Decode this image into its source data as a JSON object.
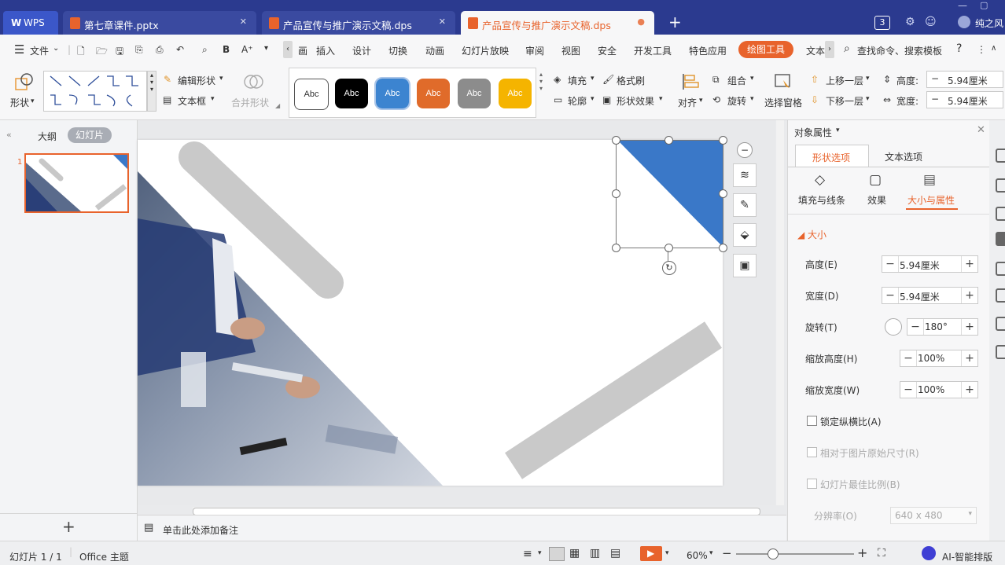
{
  "tabs": {
    "wps": "WPS",
    "items": [
      {
        "label": "第七章课件.pptx",
        "active": false
      },
      {
        "label": "产品宣传与推广演示文稿.dps",
        "active": false
      },
      {
        "label": "产品宣传与推广演示文稿.dps",
        "active": true
      }
    ],
    "page_count": "3",
    "user": "纯之风"
  },
  "menu": {
    "file": "文件",
    "items": [
      "插入",
      "设计",
      "切换",
      "动画",
      "幻灯片放映",
      "审阅",
      "视图",
      "安全",
      "开发工具",
      "特色应用"
    ],
    "drawing_tools": "绘图工具",
    "text_tools": "文本",
    "search": "查找命令、搜索模板",
    "help": "?"
  },
  "ribbon": {
    "shape": "形状",
    "edit_shape": "编辑形状",
    "text_box": "文本框",
    "merge_shape": "合并形状",
    "style_label": "Abc",
    "fill": "填充",
    "format_painter": "格式刷",
    "outline": "轮廓",
    "shape_effects": "形状效果",
    "align": "对齐",
    "group": "组合",
    "rotate": "旋转",
    "select_pane": "选择窗格",
    "bring_forward": "上移一层",
    "send_backward": "下移一层",
    "height_label": "高度:",
    "height_value": "5.94厘米",
    "width_label": "宽度:",
    "width_value": "5.94厘米",
    "colors": {
      "blue": "#3c84d0",
      "orange": "#e06b2a",
      "gray": "#8c8c8c",
      "yellow": "#f5b400"
    }
  },
  "left_panel": {
    "outline_tab": "大纲",
    "slides_tab": "幻灯片",
    "slide_number": "1",
    "add": "+"
  },
  "notes": "单击此处添加备注",
  "properties": {
    "title": "对象属性",
    "tab_shape": "形状选项",
    "tab_text": "文本选项",
    "sub_fill": "填充与线条",
    "sub_effects": "效果",
    "sub_size": "大小与属性",
    "section": "大小",
    "height_label": "高度(E)",
    "height_value": "5.94厘米",
    "width_label": "宽度(D)",
    "width_value": "5.94厘米",
    "rotate_label": "旋转(T)",
    "rotate_value": "180°",
    "scale_h_label": "缩放高度(H)",
    "scale_h_value": "100%",
    "scale_w_label": "缩放宽度(W)",
    "scale_w_value": "100%",
    "lock_ratio": "锁定纵横比(A)",
    "relative_original": "相对于图片原始尺寸(R)",
    "best_scale": "幻灯片最佳比例(B)",
    "resolution_label": "分辨率(O)",
    "resolution_value": "640 x 480"
  },
  "status": {
    "slide": "幻灯片 1 / 1",
    "theme": "Office 主题",
    "zoom": "60%",
    "ai": "AI-智能排版"
  }
}
